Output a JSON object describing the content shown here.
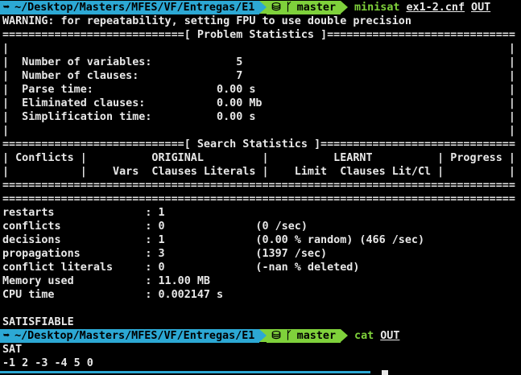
{
  "prompt1": {
    "dir_icon": "home-arrow-icon",
    "path": "~/Desktop/Masters/MFES/VF/Entregas/E1",
    "git_icon": "branch-icon",
    "branch": "master",
    "command": "minisat",
    "args": [
      "ex1-2.cnf",
      "OUT"
    ]
  },
  "output": [
    "WARNING: for repeatability, setting FPU to use double precision",
    "============================[ Problem Statistics ]=============================",
    "|                                                                             |",
    "|  Number of variables:             5                                         |",
    "|  Number of clauses:               7                                         |",
    "|  Parse time:                   0.00 s                                       |",
    "|  Eliminated clauses:           0.00 Mb                                      |",
    "|  Simplification time:          0.00 s                                       |",
    "|                                                                             |",
    "============================[ Search Statistics ]==============================",
    "| Conflicts |          ORIGINAL         |          LEARNT          | Progress |",
    "|           |    Vars  Clauses Literals |    Limit  Clauses Lit/Cl |          |",
    "===============================================================================",
    "===============================================================================",
    "restarts              : 1",
    "conflicts             : 0              (0 /sec)",
    "decisions             : 1              (0.00 % random) (466 /sec)",
    "propagations          : 3              (1397 /sec)",
    "conflict literals     : 0              (-nan % deleted)",
    "Memory used           : 11.00 MB",
    "CPU time              : 0.002147 s",
    "",
    "SATISFIABLE"
  ],
  "prompt2": {
    "dir_icon": "home-arrow-icon",
    "path": "~/Desktop/Masters/MFES/VF/Entregas/E1",
    "git_icon": "branch-icon",
    "branch": "master",
    "command": "cat",
    "args": [
      "OUT"
    ]
  },
  "output2": [
    "SAT",
    "-1 2 -3 -4 5 0"
  ],
  "colors": {
    "background": "#000000",
    "text": "#e8e8e8",
    "path_segment": "#2ca8d4",
    "git_segment": "#7fd13b",
    "command": "#7fd13b"
  }
}
